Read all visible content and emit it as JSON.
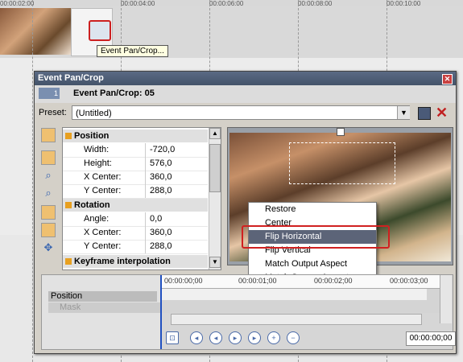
{
  "background": {
    "ruler_ticks": [
      "00:00:02:00",
      "00:00:04:00",
      "00:00:06:00",
      "00:00:08:00",
      "00:00:10:00"
    ],
    "tooltip": "Event Pan/Crop..."
  },
  "window": {
    "title": "Event Pan/Crop",
    "badge": "1",
    "header": "Event Pan/Crop: 05",
    "preset_label": "Preset:",
    "preset_value": "(Untitled)"
  },
  "grid": {
    "sections": [
      {
        "label": "Position",
        "rows": [
          {
            "k": "Width:",
            "v": "-720,0"
          },
          {
            "k": "Height:",
            "v": "576,0"
          },
          {
            "k": "X Center:",
            "v": "360,0"
          },
          {
            "k": "Y Center:",
            "v": "288,0"
          }
        ]
      },
      {
        "label": "Rotation",
        "rows": [
          {
            "k": "Angle:",
            "v": "0,0"
          },
          {
            "k": "X Center:",
            "v": "360,0"
          },
          {
            "k": "Y Center:",
            "v": "288,0"
          }
        ]
      },
      {
        "label": "Keyframe interpolation",
        "rows": []
      }
    ]
  },
  "menu": {
    "items": [
      "Restore",
      "Center",
      "Flip Horizontal",
      "Flip Vertical",
      "Match Output Aspect",
      "Match Source Aspect"
    ],
    "selected_index": 2
  },
  "keyframes": {
    "track_label": "Position",
    "mask_label": "Mask",
    "ruler": [
      "00:00:00;00",
      "00:00:01;00",
      "00:00:02;00",
      "00:00:03;00"
    ],
    "time": "00:00:00;00"
  },
  "colors": {
    "accent": "#cc2020",
    "menu_selected": "#5c6478",
    "titlebar": "#4a5a74"
  }
}
